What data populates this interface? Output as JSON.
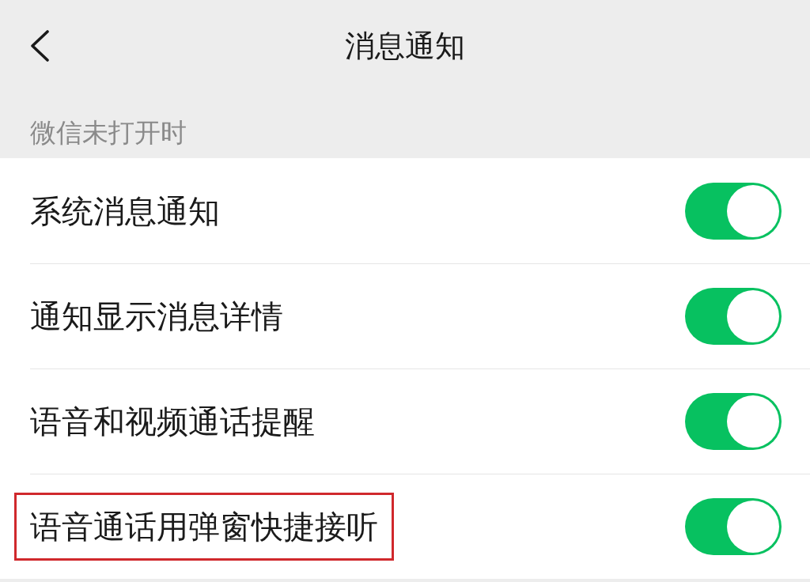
{
  "header": {
    "title": "消息通知"
  },
  "section": {
    "label": "微信未打开时"
  },
  "settings": [
    {
      "label": "系统消息通知",
      "on": true,
      "highlighted": false
    },
    {
      "label": "通知显示消息详情",
      "on": true,
      "highlighted": false
    },
    {
      "label": "语音和视频通话提醒",
      "on": true,
      "highlighted": false
    },
    {
      "label": "语音通话用弹窗快捷接听",
      "on": true,
      "highlighted": true
    }
  ]
}
